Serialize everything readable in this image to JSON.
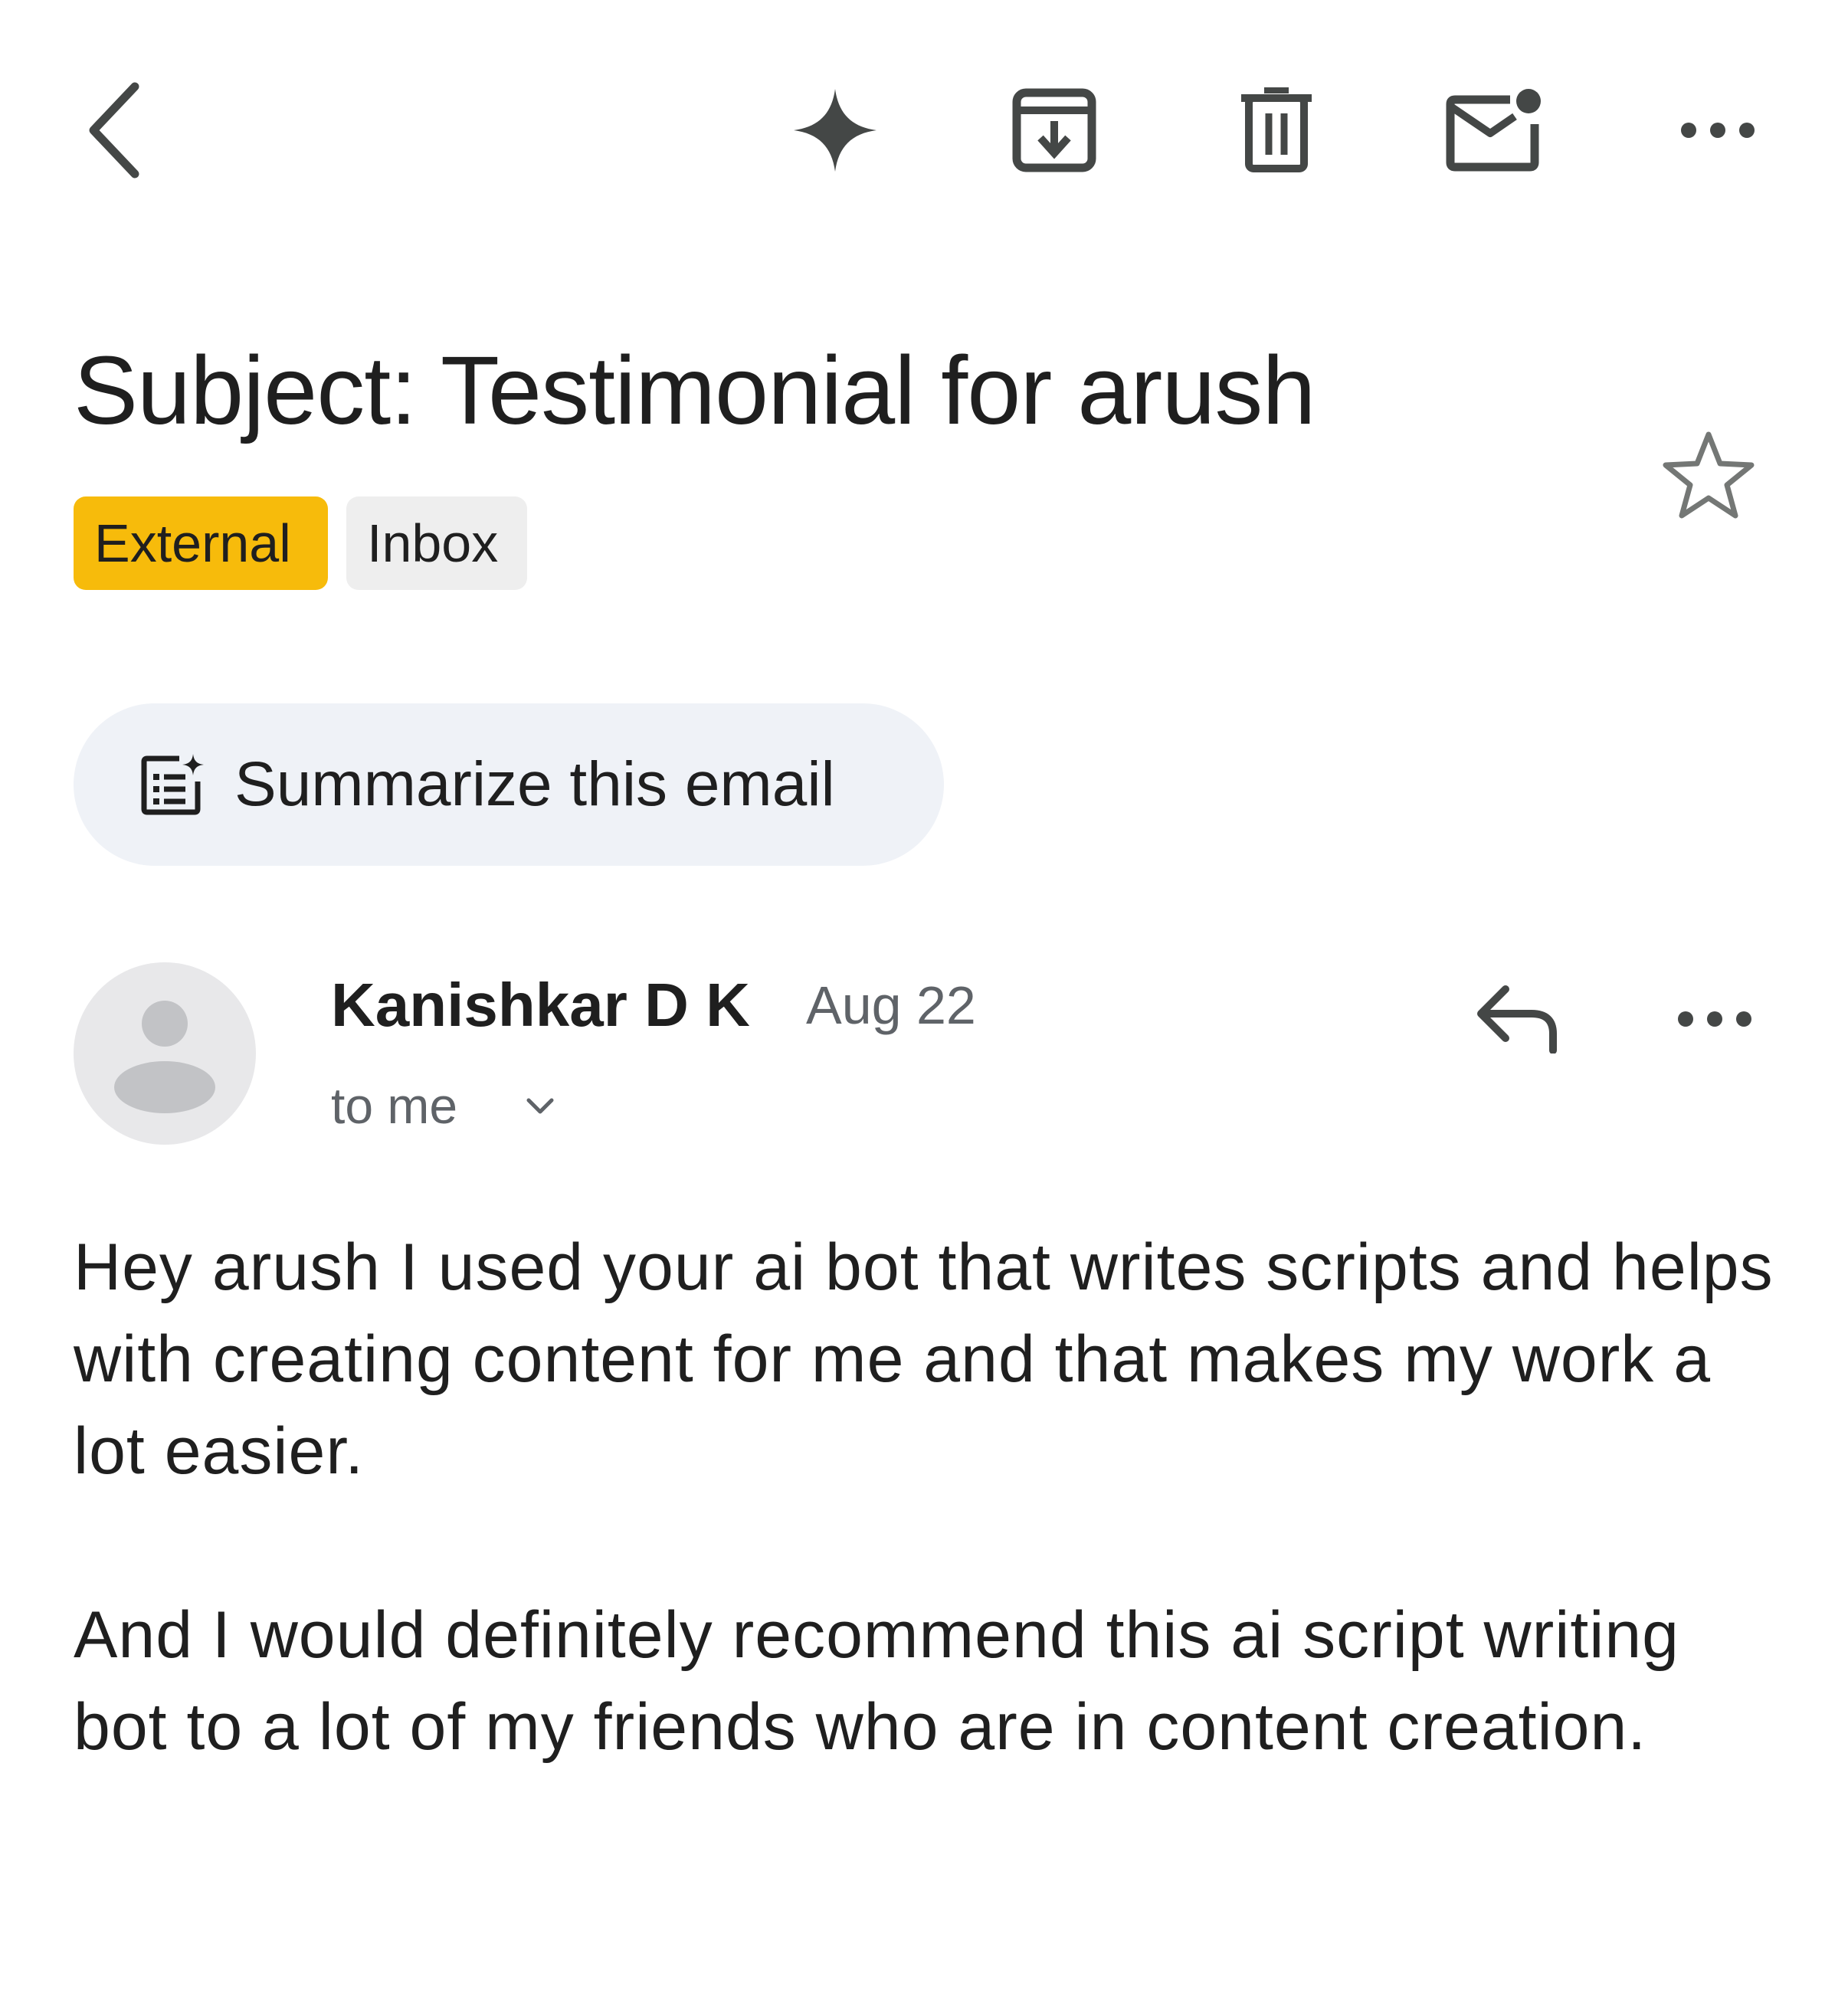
{
  "toolbar": {
    "back_icon": "chevron-left-icon",
    "gemini_icon": "sparkle-icon",
    "archive_icon": "archive-icon",
    "delete_icon": "trash-icon",
    "unread_icon": "mark-unread-icon",
    "more_icon": "more-horizontal-icon"
  },
  "email": {
    "subject": "Subject: Testimonial for arush",
    "labels": [
      "External",
      "Inbox"
    ],
    "starred": false,
    "summarize_label": "Summarize this email",
    "sender": {
      "name": "Kanishkar D K",
      "date": "Aug 22",
      "recipient": "to me"
    },
    "body": [
      "Hey arush I used your ai bot that writes scripts and helps with creating content for me and that makes my work a lot easier.",
      "And I would definitely recommend this ai  script writing bot to a lot of my friends who are in content creation."
    ]
  },
  "colors": {
    "external_chip": "#f7bb0b",
    "inbox_chip": "#eeeeee",
    "summarize_bg": "#eff2f7",
    "icon": "#444746",
    "muted_text": "#5f6368"
  }
}
